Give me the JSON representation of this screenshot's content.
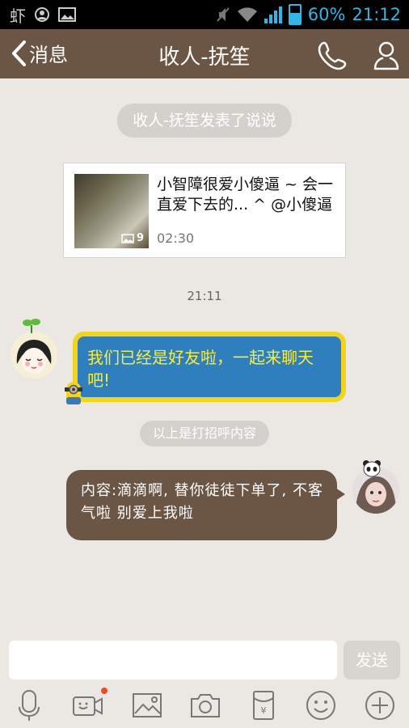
{
  "status_bar": {
    "carrier_icon": "虾",
    "battery_level": "60%",
    "time": "21:12"
  },
  "header": {
    "back_label": "消息",
    "title": "收人-抚笙"
  },
  "chat": {
    "system_notice": "收人-抚笙发表了说说",
    "shared_post": {
      "text": "小智障很爱小傻逼 ~ 会一直爱下去的... ^ @小傻逼",
      "image_count": "9",
      "time": "02:30"
    },
    "timestamp": "21:11",
    "received_message": "我们已经是好友啦，一起来聊天吧!",
    "greeting_notice": "以上是打招呼内容",
    "sent_message": "内容:滴滴啊, 替你徒徒下单了, 不客气啦 别爱上我啦"
  },
  "composer": {
    "input_value": "",
    "send_label": "发送"
  },
  "colors": {
    "header": "#6b5545",
    "background": "#ebe7e2",
    "accent": "#33b5e5",
    "notification_dot": "#f04b23"
  },
  "toolbar_icons": [
    "microphone-icon",
    "video-icon",
    "image-icon",
    "camera-icon",
    "red-packet-icon",
    "emoji-icon",
    "plus-icon"
  ]
}
